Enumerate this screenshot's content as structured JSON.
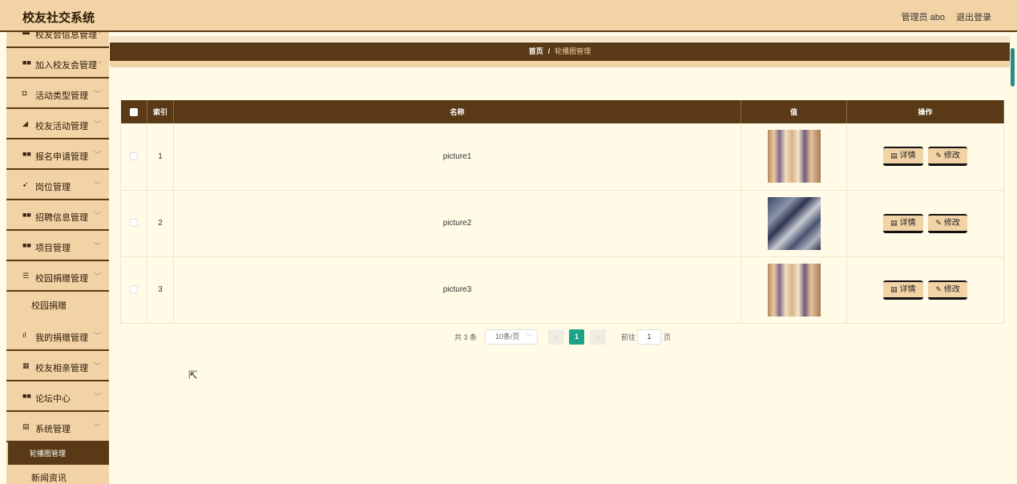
{
  "app": {
    "title": "校友社交系统",
    "user": "管理员 abo",
    "logout": "退出登录"
  },
  "sidebar": {
    "items": [
      {
        "label": "校友会信息管理",
        "icon": "▬",
        "chevron": "›"
      },
      {
        "label": "加入校友会管理",
        "icon": "■■",
        "chevron": "›"
      },
      {
        "label": "活动类型管理",
        "icon": "◘",
        "chevron": "﹀"
      },
      {
        "label": "校友活动管理",
        "icon": "◢",
        "chevron": "﹀"
      },
      {
        "label": "报名申请管理",
        "icon": "■■",
        "chevron": "﹀"
      },
      {
        "label": "岗位管理",
        "icon": "➹",
        "chevron": "﹀"
      },
      {
        "label": "招聘信息管理",
        "icon": "■■",
        "chevron": "﹀"
      },
      {
        "label": "项目管理",
        "icon": "■■",
        "chevron": "﹀"
      },
      {
        "label": "校园捐赠管理",
        "icon": "☰",
        "chevron": "﹀"
      },
      {
        "label": "校园捐赠"
      },
      {
        "label": "我的捐赠管理",
        "icon": "ıl",
        "chevron": "﹀"
      },
      {
        "label": "校友相亲管理",
        "icon": "▦",
        "chevron": "﹀"
      },
      {
        "label": "论坛中心",
        "icon": "■■",
        "chevron": "﹀"
      },
      {
        "label": "系统管理",
        "icon": "▤",
        "chevron": "﹀"
      },
      {
        "label": "轮播图管理"
      },
      {
        "label": "新闻资讯"
      }
    ]
  },
  "breadcrumb": {
    "home": "首页",
    "sep": "/",
    "current": "轮播图管理"
  },
  "table": {
    "headers": [
      "索引",
      "名称",
      "值",
      "操作"
    ],
    "rows": [
      {
        "index": "1",
        "name": "picture1",
        "thumb": "a"
      },
      {
        "index": "2",
        "name": "picture2",
        "thumb": "b"
      },
      {
        "index": "3",
        "name": "picture3",
        "thumb": "a"
      }
    ],
    "actions": {
      "detail": "详情",
      "edit": "修改",
      "detail_icon": "▤",
      "edit_icon": "✎"
    }
  },
  "pagination": {
    "total": "共 3 条",
    "page_size": "10条/页",
    "prev": "‹",
    "current": "1",
    "next": "›",
    "goto_label": "前往",
    "goto_value": "1",
    "page_suffix": "页"
  },
  "colors": {
    "header": "#f2d3a6",
    "dark": "#5a3a16",
    "accent": "#1aa387",
    "background": "#fffbe6"
  }
}
